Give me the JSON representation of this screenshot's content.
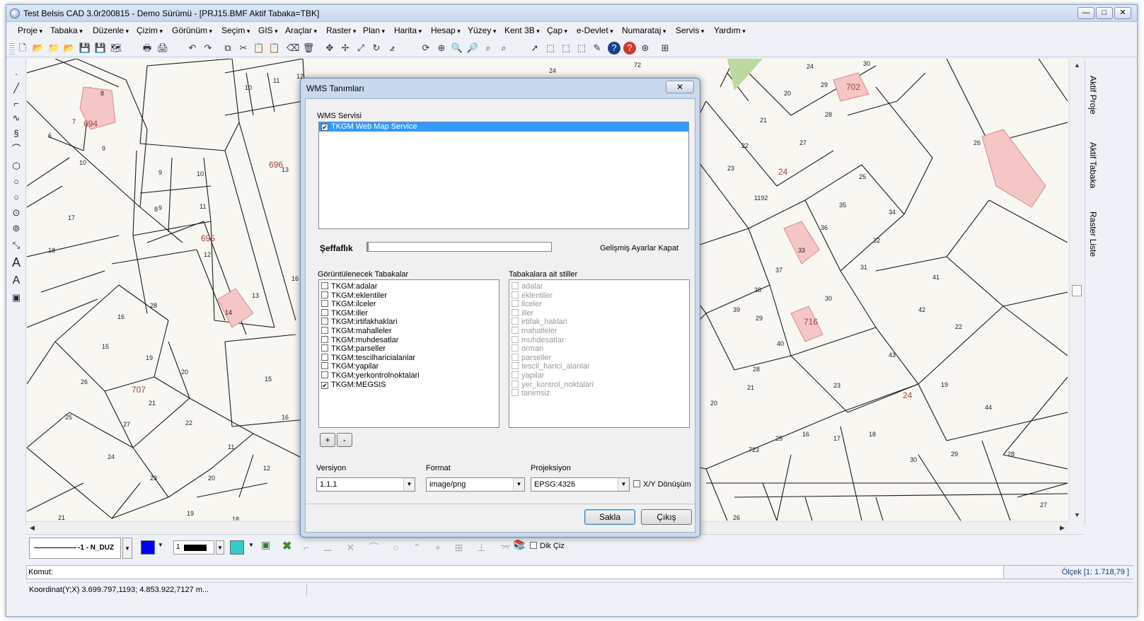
{
  "window": {
    "title": "Test Belsis CAD 3.0r200815 - Demo Sürümü - [PRJ15.BMF  Aktif Tabaka=TBK]",
    "min": "—",
    "max": "□",
    "close": "✕"
  },
  "menu": [
    "Proje",
    "Tabaka",
    "Düzenle",
    "Çizim",
    "Görünüm",
    "Seçim",
    "GIS",
    "Araçlar",
    "Raster",
    "Plan",
    "Harita",
    "Hesap",
    "Yüzey",
    "Kent 3B",
    "Çap",
    "e-Devlet",
    "Numarataj",
    "Servis",
    "Yardım"
  ],
  "right_panel": {
    "tabs": [
      "Aktif Proje",
      "Aktif Tabaka",
      "Raster Liste"
    ]
  },
  "map": {
    "labels": [
      "8",
      "7",
      "6",
      "9",
      "10",
      "694",
      "11",
      "12",
      "10",
      "9",
      "696",
      "13",
      "9",
      "10",
      "8",
      "11",
      "695",
      "12",
      "17",
      "18",
      "16",
      "13",
      "14",
      "16",
      "28",
      "15",
      "19",
      "20",
      "26",
      "707",
      "21",
      "25",
      "27",
      "22",
      "24",
      "23",
      "15",
      "16",
      "11",
      "12",
      "20",
      "19",
      "18",
      "21",
      "24",
      "72",
      "24",
      "30",
      "20",
      "29",
      "702",
      "21",
      "28",
      "22",
      "27",
      "23",
      "26",
      "24",
      "1192",
      "25",
      "35",
      "34",
      "36",
      "33",
      "32",
      "37",
      "31",
      "38",
      "30",
      "39",
      "29",
      "716",
      "40",
      "28",
      "41",
      "42",
      "22",
      "21",
      "23",
      "43",
      "19",
      "20",
      "24",
      "44",
      "723",
      "25",
      "16",
      "17",
      "18",
      "30",
      "29",
      "28",
      "27",
      "26",
      "33",
      "24"
    ],
    "parcel_color": "#f5c6c6",
    "island_color": "#a0463c"
  },
  "dialog": {
    "title": "WMS Tanımları",
    "close": "✕",
    "wms_label": "WMS Servisi",
    "wms_services": [
      {
        "name": "TKGM  Web Map Service",
        "checked": true
      }
    ],
    "transparency_label": "Şeffaflık",
    "advanced_label": "Gelişmiş Ayarlar Kapat",
    "layers_label": "Görüntülenecek Tabakalar",
    "styles_label": "Tabakalara ait stiller",
    "layers": [
      {
        "name": "TKGM:adalar",
        "checked": false
      },
      {
        "name": "TKGM:eklentiler",
        "checked": false
      },
      {
        "name": "TKGM:ilceler",
        "checked": false
      },
      {
        "name": "TKGM:iller",
        "checked": false
      },
      {
        "name": "TKGM:irtifakhaklari",
        "checked": false
      },
      {
        "name": "TKGM:mahalleler",
        "checked": false
      },
      {
        "name": "TKGM:muhdesatlar",
        "checked": false
      },
      {
        "name": "TKGM:parseller",
        "checked": false
      },
      {
        "name": "TKGM:tescilharicialanlar",
        "checked": false
      },
      {
        "name": "TKGM:yapilar",
        "checked": false
      },
      {
        "name": "TKGM:yerkontrolnoktalari",
        "checked": false
      },
      {
        "name": "TKGM:MEGSIS",
        "checked": true
      }
    ],
    "styles": [
      "adalar",
      "eklentiler",
      "ilceler",
      "iller",
      "irtifak_haklari",
      "mahalleler",
      "muhdesatlar",
      "orman",
      "parseller",
      "tescil_harici_alanlar",
      "yapilar",
      "yer_kontrol_noktalari",
      "tanimsiz"
    ],
    "add": "+",
    "remove": "-",
    "version_label": "Versiyon",
    "version_value": "1.1.1",
    "format_label": "Format",
    "format_value": "image/png",
    "projection_label": "Projeksiyon",
    "projection_value": "EPSG:4326",
    "xy_label": "X/Y Dönüşüm",
    "save": "Sakla",
    "exit": "Çıkış"
  },
  "bottom": {
    "linetype": "-1 - N_DUZ",
    "line_color": "#0000ff",
    "fill_color": "#33cccc",
    "width_value": "1",
    "dik_ciz": "Dik Çiz"
  },
  "command_label": "Komut:",
  "scale": "Ölçek [1: 1.718,79 ]",
  "coords": "Koordinat(Y;X)  3.699.797,1193; 4.853.922,7127 m..."
}
